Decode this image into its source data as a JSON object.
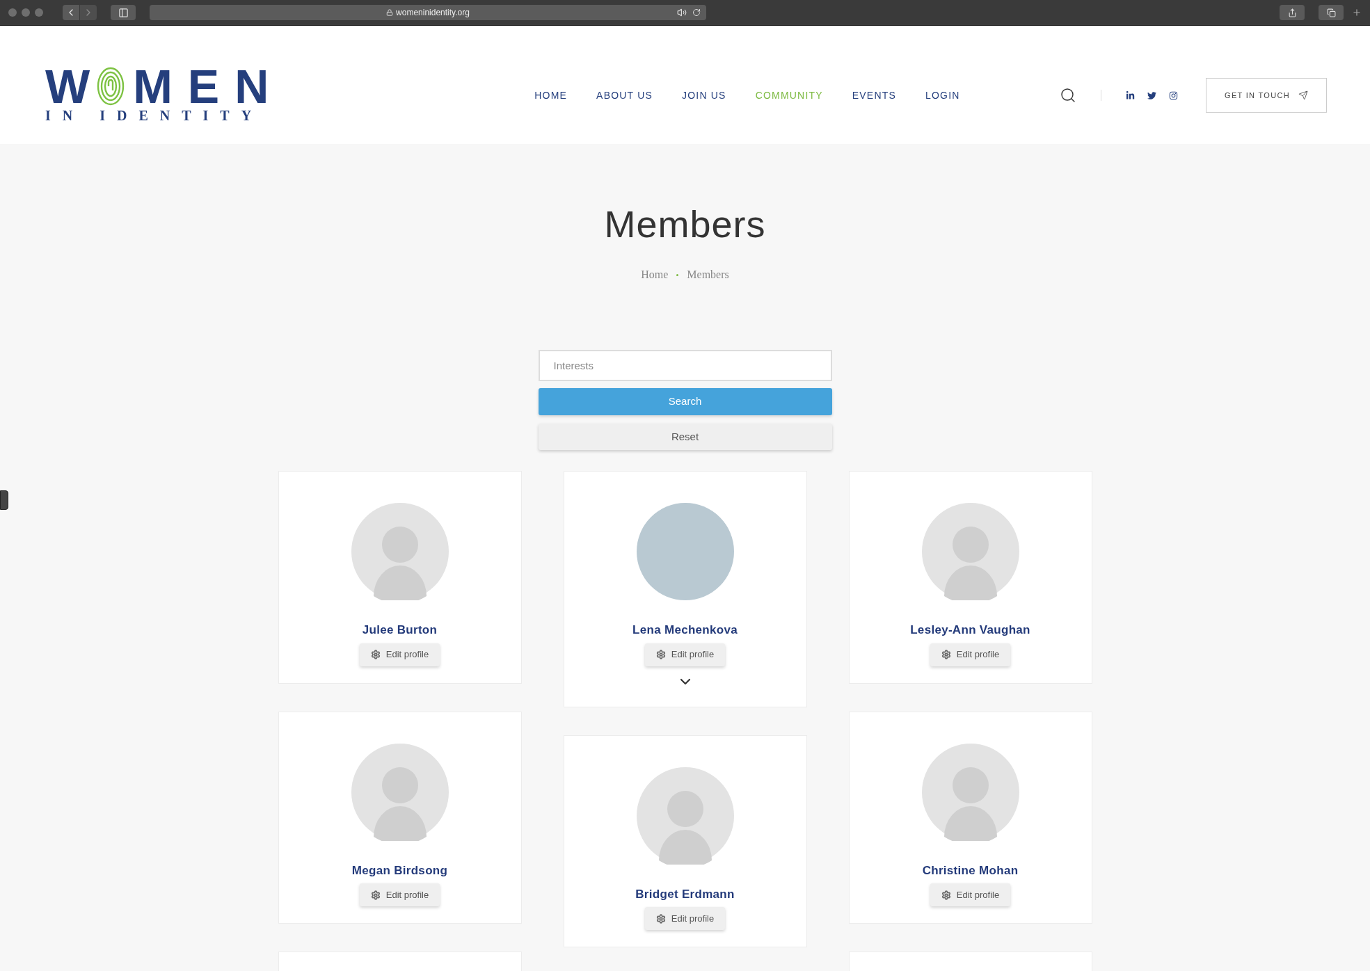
{
  "browser": {
    "url": "womeninidentity.org"
  },
  "logo": {
    "left": "W",
    "right": "MEN",
    "tagline": "IN IDENTITY"
  },
  "nav": [
    {
      "label": "HOME",
      "selected": false
    },
    {
      "label": "ABOUT US",
      "selected": false
    },
    {
      "label": "JOIN US",
      "selected": false
    },
    {
      "label": "COMMUNITY",
      "selected": true
    },
    {
      "label": "EVENTS",
      "selected": false
    },
    {
      "label": "LOGIN",
      "selected": false
    }
  ],
  "cta": "GET IN TOUCH",
  "page": {
    "title": "Members",
    "breadcrumb": [
      "Home",
      "Members"
    ]
  },
  "filter": {
    "placeholder": "Interests",
    "search": "Search",
    "reset": "Reset"
  },
  "columns": [
    {
      "members": [
        {
          "name": "Julee Burton",
          "photo": false,
          "expandable": false,
          "action": "Edit profile"
        },
        {
          "name": "Megan Birdsong",
          "photo": false,
          "expandable": false,
          "action": "Edit profile"
        }
      ]
    },
    {
      "members": [
        {
          "name": "Lena Mechenkova",
          "photo": true,
          "expandable": true,
          "action": "Edit profile"
        },
        {
          "name": "Bridget Erdmann",
          "photo": false,
          "expandable": false,
          "action": "Edit profile"
        }
      ]
    },
    {
      "members": [
        {
          "name": "Lesley-Ann Vaughan",
          "photo": false,
          "expandable": false,
          "action": "Edit profile"
        },
        {
          "name": "Christine Mohan",
          "photo": false,
          "expandable": false,
          "action": "Edit profile"
        }
      ]
    }
  ]
}
